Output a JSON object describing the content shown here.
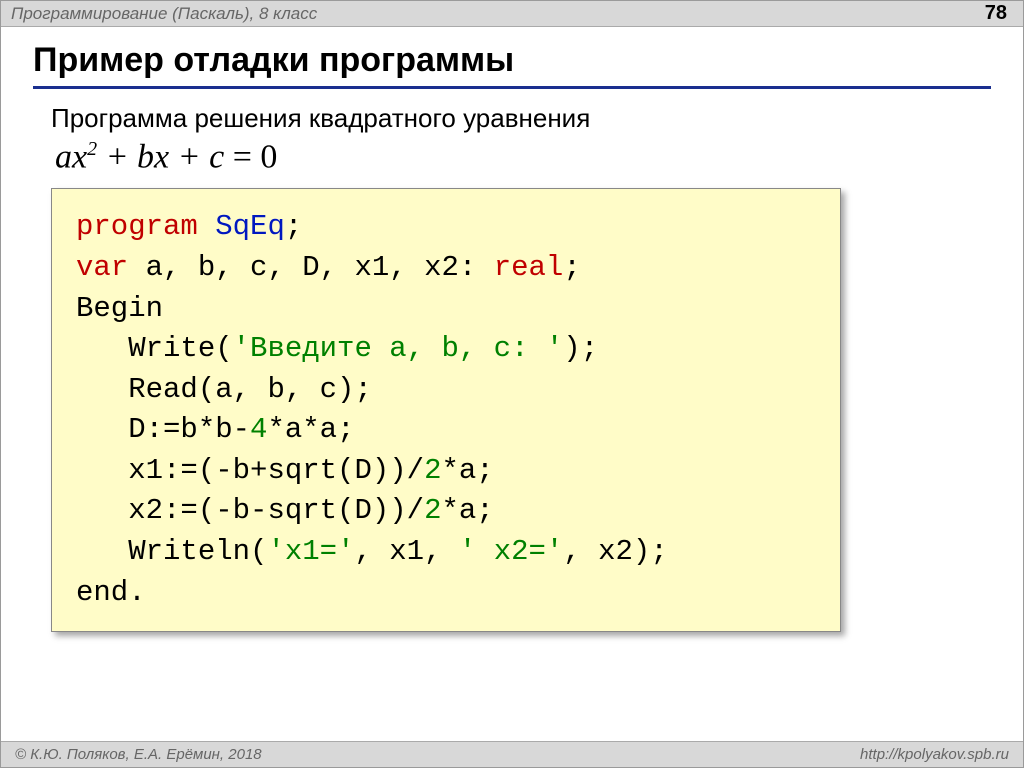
{
  "header": {
    "course": "Программирование (Паскаль), 8 класс",
    "page": "78"
  },
  "title": "Пример отладки программы",
  "subtitle": "Программа решения квадратного уравнения",
  "formula": {
    "a": "a",
    "x": "x",
    "sup": "2",
    "plus1": " + ",
    "b": "b",
    "x2": "x",
    "plus2": " + ",
    "c": "c",
    "eq": " = ",
    "zero": "0"
  },
  "code": {
    "program_kw": "program",
    "sp": " ",
    "progname": "SqEq",
    "semi": ";",
    "var_kw": "var",
    "varlist": " a, b, c, D, x1, x2: ",
    "real_kw": "real",
    "begin_kw": "Begin",
    "ind": "   ",
    "write": "Write(",
    "prompt": "'Введите a, b, c: '",
    "close_paren_semi": ");",
    "read": "Read(a, b, c);",
    "dline_a": "D:=b*b-",
    "four": "4",
    "dline_b": "*a*a;",
    "x1a": "x1:=(-b+sqrt(D))/",
    "two": "2",
    "x1b": "*a;",
    "x2a": "x2:=(-b-sqrt(D))/",
    "x2b": "*a;",
    "writeln": "Writeln(",
    "s_x1": "'x1='",
    "comma_x1": ", x1, ",
    "s_x2": "' x2='",
    "comma_x2": ", x2);",
    "end_kw": "end."
  },
  "footer": {
    "authors": "© К.Ю. Поляков, Е.А. Ерёмин, 2018",
    "url": "http://kpolyakov.spb.ru"
  }
}
